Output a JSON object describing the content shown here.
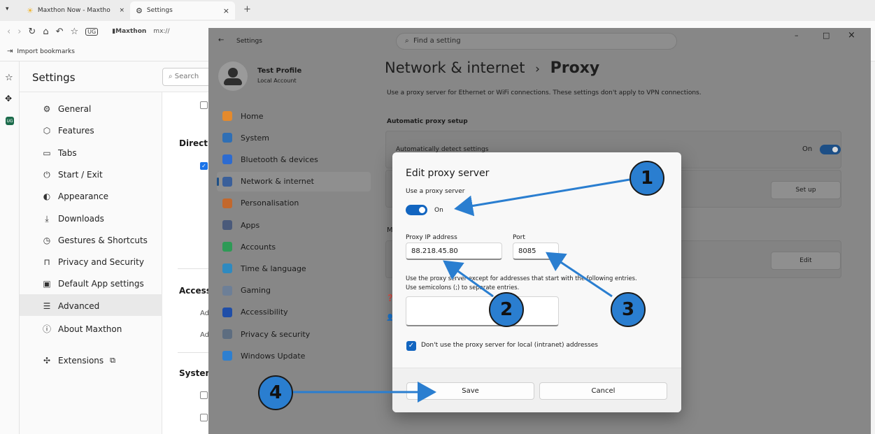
{
  "browser": {
    "tabs": [
      {
        "label": "Maxthon Now - Maxtho"
      },
      {
        "label": "Settings"
      }
    ],
    "close_glyph": "×",
    "new_tab_glyph": "+",
    "address_prefix": "Maxthon",
    "address_text": "mx://",
    "import_bookmarks": "Import bookmarks"
  },
  "mx_settings": {
    "title": "Settings",
    "search_placeholder": "Search",
    "items": [
      {
        "label": "General",
        "icon": "gear-icon"
      },
      {
        "label": "Features",
        "icon": "shield-icon"
      },
      {
        "label": "Tabs",
        "icon": "tab-icon"
      },
      {
        "label": "Start / Exit",
        "icon": "power-icon"
      },
      {
        "label": "Appearance",
        "icon": "palette-icon"
      },
      {
        "label": "Downloads",
        "icon": "download-icon"
      },
      {
        "label": "Gestures & Shortcuts",
        "icon": "clock-icon"
      },
      {
        "label": "Privacy and Security",
        "icon": "lock-icon"
      },
      {
        "label": "Default App settings",
        "icon": "app-icon"
      },
      {
        "label": "Advanced",
        "icon": "sliders-icon"
      },
      {
        "label": "About Maxthon",
        "icon": "info-icon"
      }
    ],
    "extensions": "Extensions",
    "main_fragments": {
      "direct": "Direct",
      "access": "Access",
      "ad1": "Ad",
      "ad2": "Ad",
      "system": "System"
    }
  },
  "win": {
    "back_label": "Settings",
    "search_placeholder": "Find a setting",
    "profile_name": "Test Profile",
    "profile_sub": "Local Account",
    "nav": [
      {
        "label": "Home",
        "color": "#e58a2c"
      },
      {
        "label": "System",
        "color": "#2f6fb5"
      },
      {
        "label": "Bluetooth & devices",
        "color": "#2d6bd0"
      },
      {
        "label": "Network & internet",
        "color": "#3a5f9a"
      },
      {
        "label": "Personalisation",
        "color": "#c2682d"
      },
      {
        "label": "Apps",
        "color": "#4a5a7a"
      },
      {
        "label": "Accounts",
        "color": "#2e9a56"
      },
      {
        "label": "Time & language",
        "color": "#2f8ac0"
      },
      {
        "label": "Gaming",
        "color": "#6d7f97"
      },
      {
        "label": "Accessibility",
        "color": "#1f4ea8"
      },
      {
        "label": "Privacy & security",
        "color": "#5d6d80"
      },
      {
        "label": "Windows Update",
        "color": "#2d7fd0"
      }
    ],
    "breadcrumb_parent": "Network & internet",
    "breadcrumb_sep": "›",
    "breadcrumb_current": "Proxy",
    "description": "Use a proxy server for Ethernet or WiFi connections. These settings don't apply to VPN connections.",
    "auto_heading": "Automatic proxy setup",
    "auto_detect": "Automatically detect settings",
    "auto_detect_state": "On",
    "setup_button": "Set up",
    "edit_button": "Edit",
    "manual_fragment": "M",
    "minimize": "–",
    "maximize": "□",
    "close": "×"
  },
  "dialog": {
    "title": "Edit proxy server",
    "use_proxy_label": "Use a proxy server",
    "use_proxy_state": "On",
    "ip_label": "Proxy IP address",
    "ip_value": "88.218.45.80",
    "port_label": "Port",
    "port_value": "8085",
    "exceptions_line1": "Use the proxy server except for addresses that start with the following entries.",
    "exceptions_line2": "Use semicolons (;) to separate entries.",
    "exceptions_value": "",
    "local_checkbox": "Don't use the proxy server for local (intranet) addresses",
    "save": "Save",
    "cancel": "Cancel"
  },
  "annotations": {
    "b1": "1",
    "b2": "2",
    "b3": "3",
    "b4": "4",
    "color": "#2a7ed0"
  }
}
